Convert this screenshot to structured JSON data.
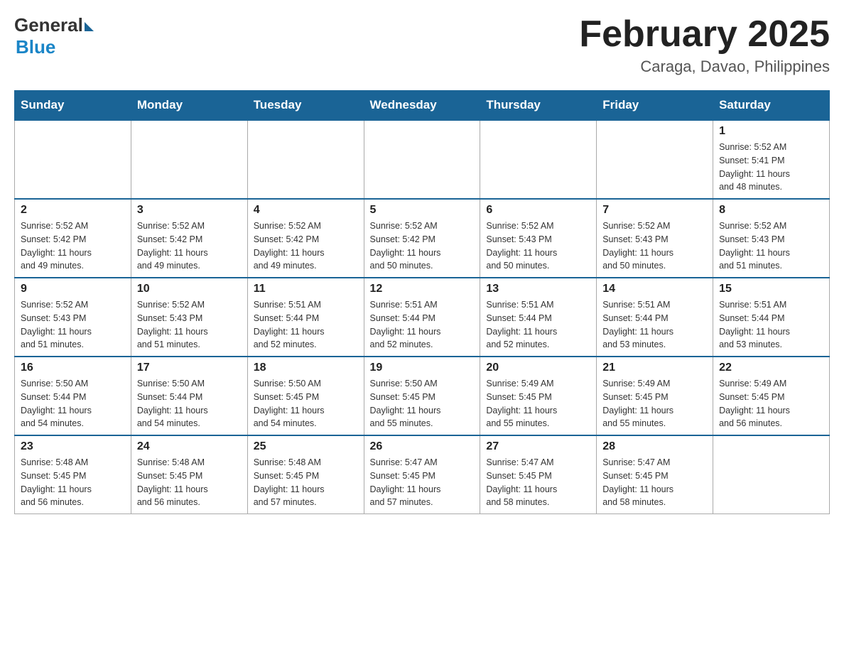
{
  "header": {
    "logo_general": "General",
    "logo_blue": "Blue",
    "month_title": "February 2025",
    "location": "Caraga, Davao, Philippines"
  },
  "days_of_week": [
    "Sunday",
    "Monday",
    "Tuesday",
    "Wednesday",
    "Thursday",
    "Friday",
    "Saturday"
  ],
  "weeks": [
    {
      "days": [
        {
          "number": "",
          "info": ""
        },
        {
          "number": "",
          "info": ""
        },
        {
          "number": "",
          "info": ""
        },
        {
          "number": "",
          "info": ""
        },
        {
          "number": "",
          "info": ""
        },
        {
          "number": "",
          "info": ""
        },
        {
          "number": "1",
          "info": "Sunrise: 5:52 AM\nSunset: 5:41 PM\nDaylight: 11 hours\nand 48 minutes."
        }
      ]
    },
    {
      "days": [
        {
          "number": "2",
          "info": "Sunrise: 5:52 AM\nSunset: 5:42 PM\nDaylight: 11 hours\nand 49 minutes."
        },
        {
          "number": "3",
          "info": "Sunrise: 5:52 AM\nSunset: 5:42 PM\nDaylight: 11 hours\nand 49 minutes."
        },
        {
          "number": "4",
          "info": "Sunrise: 5:52 AM\nSunset: 5:42 PM\nDaylight: 11 hours\nand 49 minutes."
        },
        {
          "number": "5",
          "info": "Sunrise: 5:52 AM\nSunset: 5:42 PM\nDaylight: 11 hours\nand 50 minutes."
        },
        {
          "number": "6",
          "info": "Sunrise: 5:52 AM\nSunset: 5:43 PM\nDaylight: 11 hours\nand 50 minutes."
        },
        {
          "number": "7",
          "info": "Sunrise: 5:52 AM\nSunset: 5:43 PM\nDaylight: 11 hours\nand 50 minutes."
        },
        {
          "number": "8",
          "info": "Sunrise: 5:52 AM\nSunset: 5:43 PM\nDaylight: 11 hours\nand 51 minutes."
        }
      ]
    },
    {
      "days": [
        {
          "number": "9",
          "info": "Sunrise: 5:52 AM\nSunset: 5:43 PM\nDaylight: 11 hours\nand 51 minutes."
        },
        {
          "number": "10",
          "info": "Sunrise: 5:52 AM\nSunset: 5:43 PM\nDaylight: 11 hours\nand 51 minutes."
        },
        {
          "number": "11",
          "info": "Sunrise: 5:51 AM\nSunset: 5:44 PM\nDaylight: 11 hours\nand 52 minutes."
        },
        {
          "number": "12",
          "info": "Sunrise: 5:51 AM\nSunset: 5:44 PM\nDaylight: 11 hours\nand 52 minutes."
        },
        {
          "number": "13",
          "info": "Sunrise: 5:51 AM\nSunset: 5:44 PM\nDaylight: 11 hours\nand 52 minutes."
        },
        {
          "number": "14",
          "info": "Sunrise: 5:51 AM\nSunset: 5:44 PM\nDaylight: 11 hours\nand 53 minutes."
        },
        {
          "number": "15",
          "info": "Sunrise: 5:51 AM\nSunset: 5:44 PM\nDaylight: 11 hours\nand 53 minutes."
        }
      ]
    },
    {
      "days": [
        {
          "number": "16",
          "info": "Sunrise: 5:50 AM\nSunset: 5:44 PM\nDaylight: 11 hours\nand 54 minutes."
        },
        {
          "number": "17",
          "info": "Sunrise: 5:50 AM\nSunset: 5:44 PM\nDaylight: 11 hours\nand 54 minutes."
        },
        {
          "number": "18",
          "info": "Sunrise: 5:50 AM\nSunset: 5:45 PM\nDaylight: 11 hours\nand 54 minutes."
        },
        {
          "number": "19",
          "info": "Sunrise: 5:50 AM\nSunset: 5:45 PM\nDaylight: 11 hours\nand 55 minutes."
        },
        {
          "number": "20",
          "info": "Sunrise: 5:49 AM\nSunset: 5:45 PM\nDaylight: 11 hours\nand 55 minutes."
        },
        {
          "number": "21",
          "info": "Sunrise: 5:49 AM\nSunset: 5:45 PM\nDaylight: 11 hours\nand 55 minutes."
        },
        {
          "number": "22",
          "info": "Sunrise: 5:49 AM\nSunset: 5:45 PM\nDaylight: 11 hours\nand 56 minutes."
        }
      ]
    },
    {
      "days": [
        {
          "number": "23",
          "info": "Sunrise: 5:48 AM\nSunset: 5:45 PM\nDaylight: 11 hours\nand 56 minutes."
        },
        {
          "number": "24",
          "info": "Sunrise: 5:48 AM\nSunset: 5:45 PM\nDaylight: 11 hours\nand 56 minutes."
        },
        {
          "number": "25",
          "info": "Sunrise: 5:48 AM\nSunset: 5:45 PM\nDaylight: 11 hours\nand 57 minutes."
        },
        {
          "number": "26",
          "info": "Sunrise: 5:47 AM\nSunset: 5:45 PM\nDaylight: 11 hours\nand 57 minutes."
        },
        {
          "number": "27",
          "info": "Sunrise: 5:47 AM\nSunset: 5:45 PM\nDaylight: 11 hours\nand 58 minutes."
        },
        {
          "number": "28",
          "info": "Sunrise: 5:47 AM\nSunset: 5:45 PM\nDaylight: 11 hours\nand 58 minutes."
        },
        {
          "number": "",
          "info": ""
        }
      ]
    }
  ]
}
